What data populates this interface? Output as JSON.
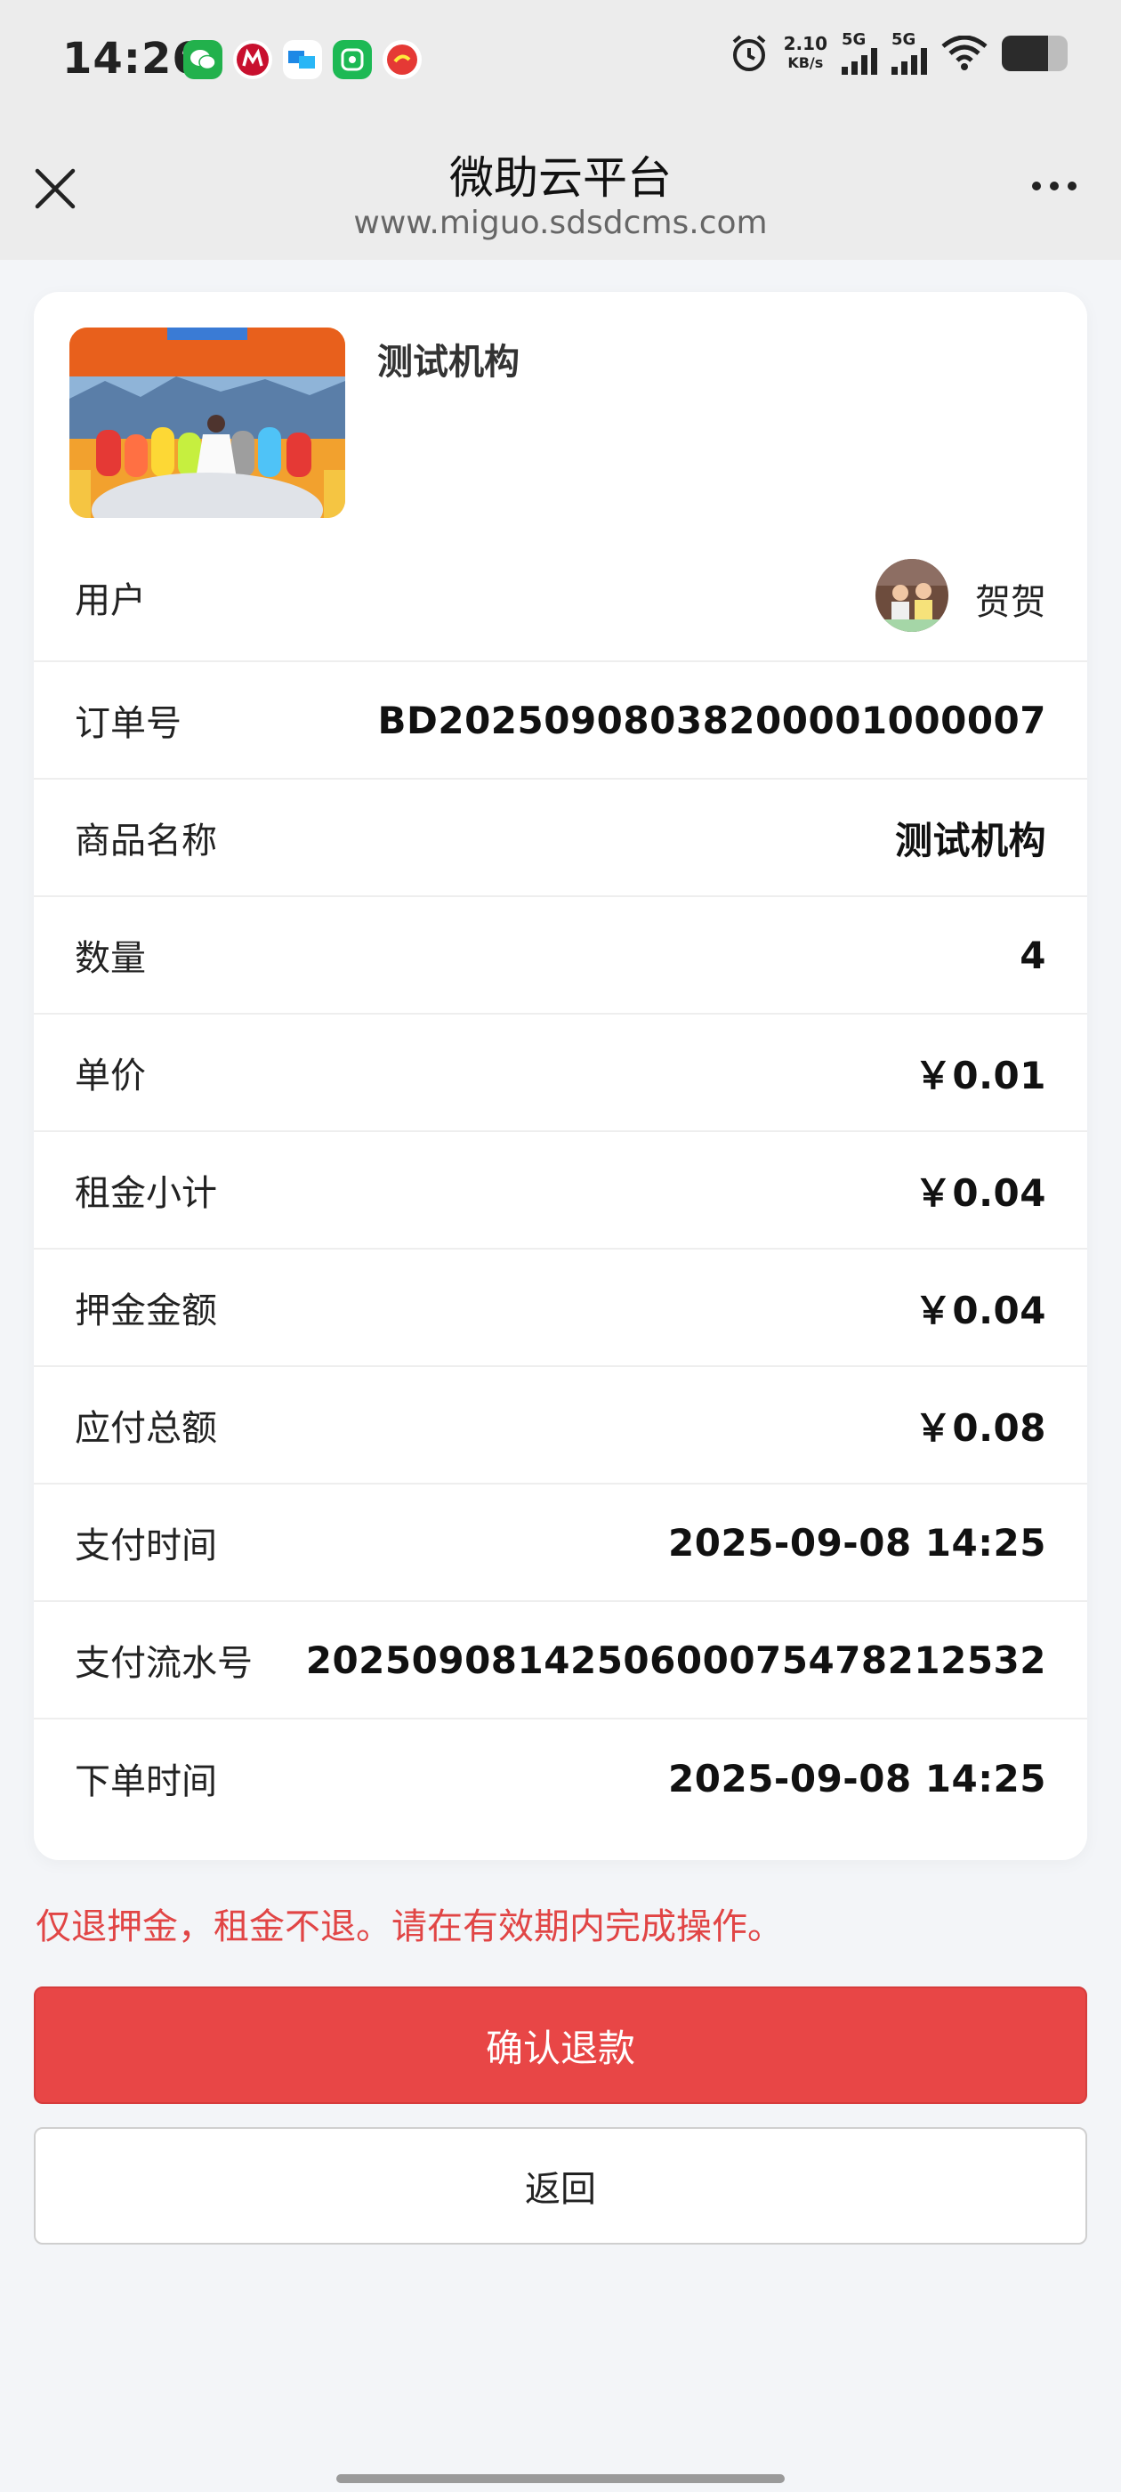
{
  "status_bar": {
    "time": "14:26",
    "net_speed_value": "2.10",
    "net_speed_unit": "KB/s",
    "sim1": "5G",
    "sim2": "5G",
    "battery_level": 0.7,
    "notification_icons": [
      "wechat-icon",
      "cmb-bank-icon",
      "message-app-icon",
      "phone-app-icon",
      "red-app-icon"
    ]
  },
  "header": {
    "title": "微助云平台",
    "subtitle": "www.miguo.sdsdcms.com"
  },
  "product": {
    "title": "测试机构"
  },
  "user": {
    "label": "用户",
    "name": "贺贺"
  },
  "details": [
    {
      "label": "订单号",
      "value": "BD2025090803820000​1000007"
    },
    {
      "label": "商品名称",
      "value": "测试机构"
    },
    {
      "label": "数量",
      "value": "4"
    },
    {
      "label": "单价",
      "value": "￥0.01"
    },
    {
      "label": "租金小计",
      "value": "￥0.04"
    },
    {
      "label": "押金金额",
      "value": "￥0.04"
    },
    {
      "label": "应付总额",
      "value": "￥0.08"
    },
    {
      "label": "支付时间",
      "value": "2025-09-08 14:25"
    },
    {
      "label": "支付流水号",
      "value": "202509081425060007547​8212532"
    },
    {
      "label": "下单时间",
      "value": "2025-09-08 14:25"
    }
  ],
  "notice": "仅退押金，租金不退。请在有效期内完成操作。",
  "actions": {
    "confirm_refund": "确认退款",
    "back": "返回"
  },
  "colors": {
    "primary_red": "#e84646",
    "notice_red": "#e14545",
    "page_bg": "#f3f5f8"
  }
}
